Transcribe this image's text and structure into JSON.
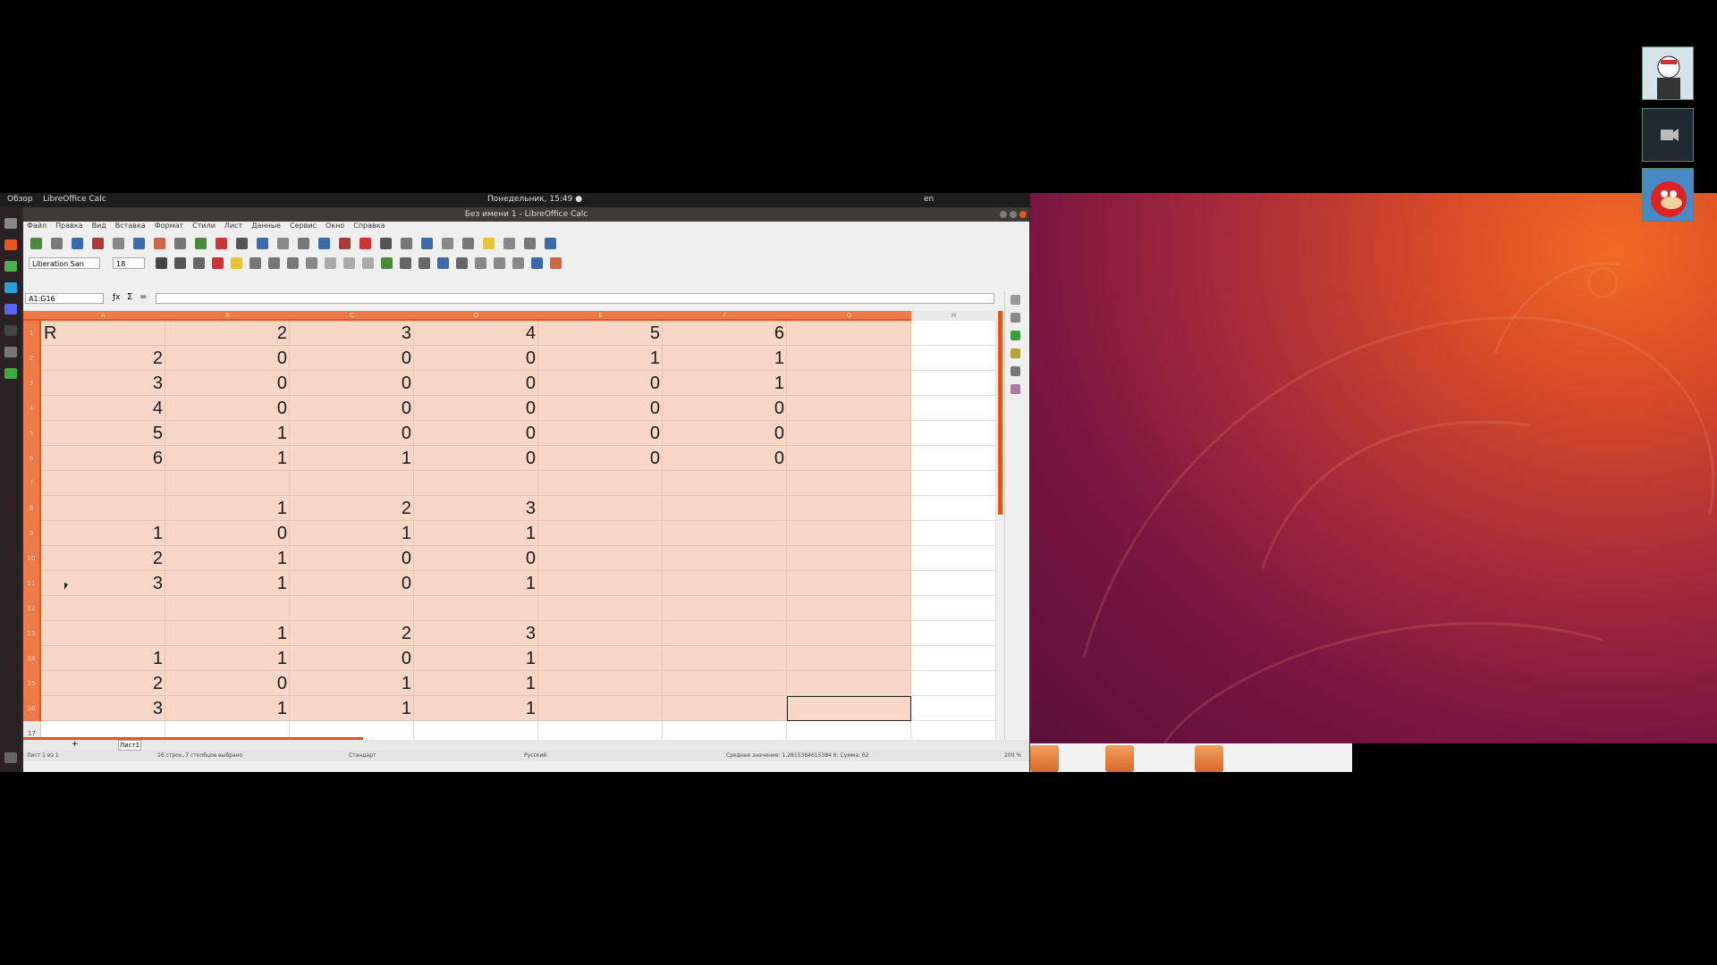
{
  "top_bar": {
    "activities": "Обзор",
    "app_menu": "LibreOffice Calc",
    "clock": "Понедельник, 15:49 ●",
    "keyboard_layout": "en"
  },
  "window": {
    "title": "Без имени 1 - LibreOffice Calc"
  },
  "menu": [
    "Файл",
    "Правка",
    "Вид",
    "Вставка",
    "Формат",
    "Стили",
    "Лист",
    "Данные",
    "Сервис",
    "Окно",
    "Справка"
  ],
  "formatting": {
    "font_name": "Liberation San",
    "font_size": "18"
  },
  "name_box": "A1:G16",
  "columns": [
    "A",
    "B",
    "C",
    "D",
    "E",
    "F",
    "G",
    "H"
  ],
  "rows": [
    [
      "R",
      "2",
      "3",
      "4",
      "5",
      "6",
      ""
    ],
    [
      "2",
      "0",
      "0",
      "0",
      "1",
      "1",
      ""
    ],
    [
      "3",
      "0",
      "0",
      "0",
      "0",
      "1",
      ""
    ],
    [
      "4",
      "0",
      "0",
      "0",
      "0",
      "0",
      ""
    ],
    [
      "5",
      "1",
      "0",
      "0",
      "0",
      "0",
      ""
    ],
    [
      "6",
      "1",
      "1",
      "0",
      "0",
      "0",
      ""
    ],
    [
      "",
      "",
      "",
      "",
      "",
      "",
      ""
    ],
    [
      "",
      "1",
      "2",
      "3",
      "",
      "",
      ""
    ],
    [
      "1",
      "0",
      "1",
      "1",
      "",
      "",
      ""
    ],
    [
      "2",
      "1",
      "0",
      "0",
      "",
      "",
      ""
    ],
    [
      "3",
      "1",
      "0",
      "1",
      "",
      "",
      ""
    ],
    [
      "",
      "",
      "",
      "",
      "",
      "",
      ""
    ],
    [
      "",
      "1",
      "2",
      "3",
      "",
      "",
      ""
    ],
    [
      "1",
      "1",
      "0",
      "1",
      "",
      "",
      ""
    ],
    [
      "2",
      "0",
      "1",
      "1",
      "",
      "",
      ""
    ],
    [
      "3",
      "1",
      "1",
      "1",
      "",
      "",
      ""
    ],
    [
      "",
      "",
      "",
      "",
      "",
      "",
      ""
    ]
  ],
  "sheet_tab": "Лист1",
  "status": {
    "sheet": "Лист 1 из 1",
    "selection": "16 строк, 7 столбцов выбрано",
    "style": "Стандарт",
    "language": "Русский",
    "summary": "Среднее значение: 1,2815384615384 6; Сумма: 62",
    "zoom": "200 %"
  },
  "colors": {
    "selection_fill": "#f9d7c6",
    "header_accent": "#ee7a4a",
    "wallpaper_orange": "#e8552a",
    "wallpaper_purple": "#6a1240"
  }
}
